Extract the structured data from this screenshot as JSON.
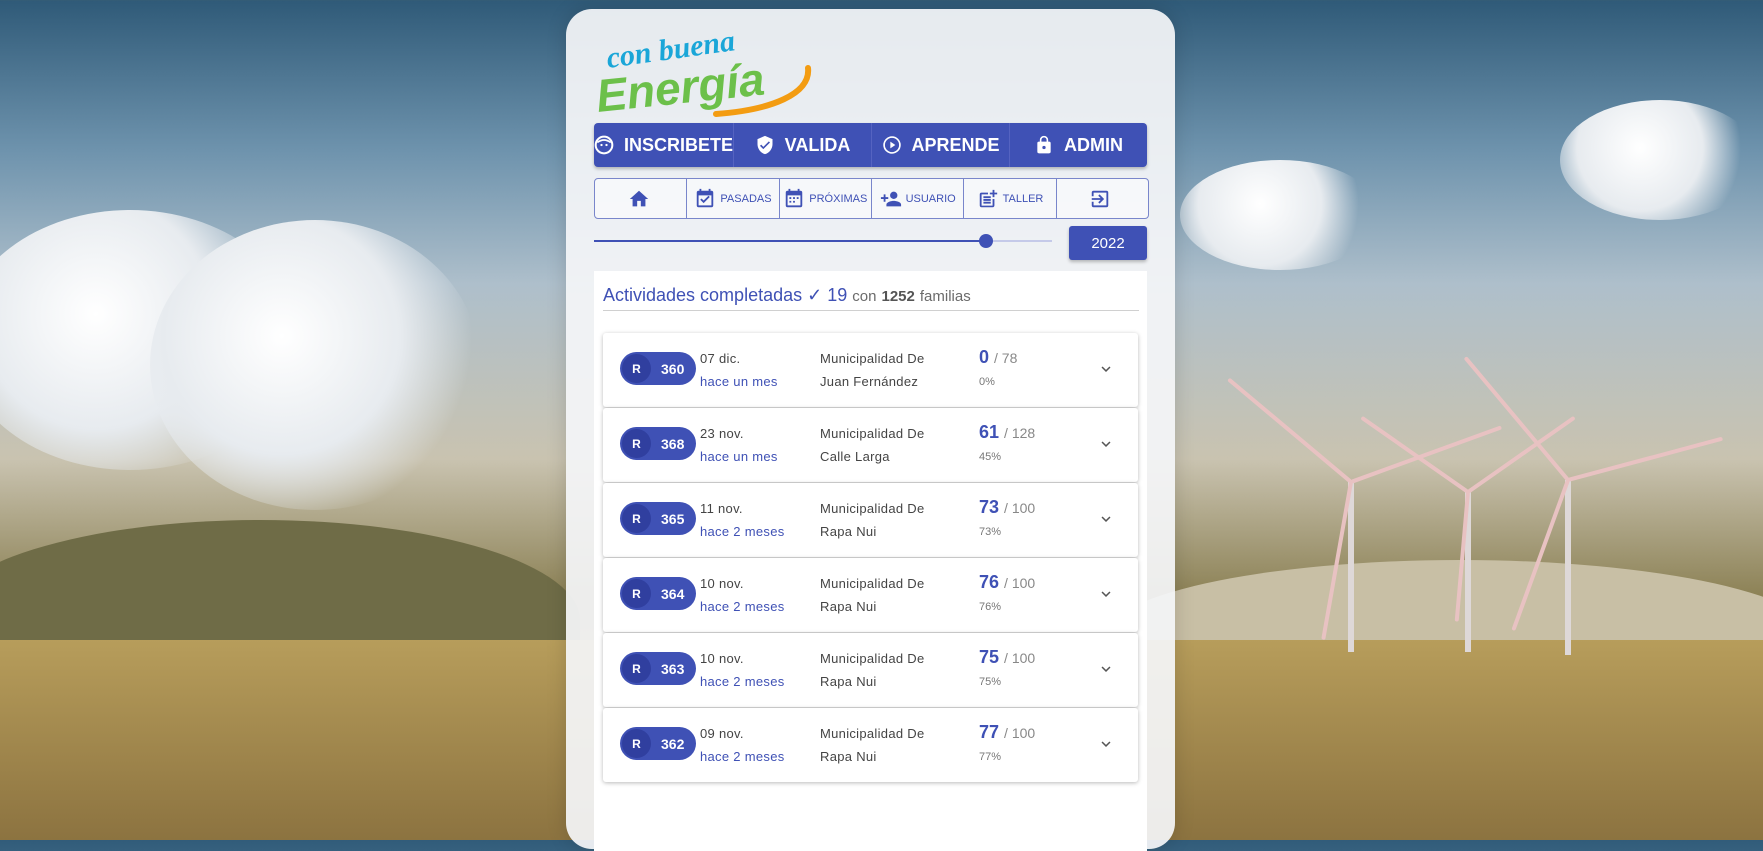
{
  "brand": {
    "logo_line1": "con buena",
    "logo_line2": "Energía"
  },
  "top_nav": [
    {
      "label": "INSCRIBETE",
      "icon": "face-icon"
    },
    {
      "label": "VALIDA",
      "icon": "shield-check-icon"
    },
    {
      "label": "APRENDE",
      "icon": "play-circle-icon"
    },
    {
      "label": "ADMIN",
      "icon": "lock-icon"
    }
  ],
  "sub_nav": [
    {
      "label": "",
      "icon": "home-icon"
    },
    {
      "label": "PASADAS",
      "icon": "calendar-check-icon"
    },
    {
      "label": "PRÓXIMAS",
      "icon": "calendar-icon"
    },
    {
      "label": "USUARIO",
      "icon": "person-add-icon"
    },
    {
      "label": "TALLER",
      "icon": "post-add-icon"
    },
    {
      "label": "",
      "icon": "logout-icon"
    }
  ],
  "year_slider": {
    "value_fraction": 0.855
  },
  "year_button": "2022",
  "activities": {
    "heading": "Actividades completadas",
    "check": "✓",
    "count": "19",
    "con": "con",
    "families": "1252",
    "families_label": "familias",
    "items": [
      {
        "chip_letter": "R",
        "id": "360",
        "date": "07 dic.",
        "ago": "hace un mes",
        "muni_line1": "Municipalidad De",
        "muni_line2": "Juan Fernández",
        "count": "0",
        "total": "/ 78",
        "pct": "0%"
      },
      {
        "chip_letter": "R",
        "id": "368",
        "date": "23 nov.",
        "ago": "hace un mes",
        "muni_line1": "Municipalidad De",
        "muni_line2": "Calle Larga",
        "count": "61",
        "total": "/ 128",
        "pct": "45%"
      },
      {
        "chip_letter": "R",
        "id": "365",
        "date": "11 nov.",
        "ago": "hace 2 meses",
        "muni_line1": "Municipalidad De",
        "muni_line2": "Rapa Nui",
        "count": "73",
        "total": "/ 100",
        "pct": "73%"
      },
      {
        "chip_letter": "R",
        "id": "364",
        "date": "10 nov.",
        "ago": "hace 2 meses",
        "muni_line1": "Municipalidad De",
        "muni_line2": "Rapa Nui",
        "count": "76",
        "total": "/ 100",
        "pct": "76%"
      },
      {
        "chip_letter": "R",
        "id": "363",
        "date": "10 nov.",
        "ago": "hace 2 meses",
        "muni_line1": "Municipalidad De",
        "muni_line2": "Rapa Nui",
        "count": "75",
        "total": "/ 100",
        "pct": "75%"
      },
      {
        "chip_letter": "R",
        "id": "362",
        "date": "09 nov.",
        "ago": "hace 2 meses",
        "muni_line1": "Municipalidad De",
        "muni_line2": "Rapa Nui",
        "count": "77",
        "total": "/ 100",
        "pct": "77%"
      }
    ]
  },
  "colors": {
    "primary": "#3f51b5",
    "primary_dark": "#303f9f",
    "logo_green": "#6cc04a",
    "logo_cyan": "#1aa6d8",
    "logo_orange": "#f39c12"
  }
}
